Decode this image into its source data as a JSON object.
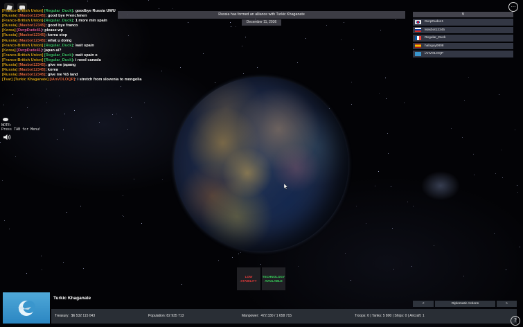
{
  "chat": [
    {
      "tag": "[Franco-British Union]",
      "name": "[Regular_Duck]",
      "name_color": "green",
      "message": "goodbye Russia UWU"
    },
    {
      "tag": "[Russia]",
      "name": "[Masbot12345]",
      "name_color": "orange",
      "message": "good bye Frenchmen"
    },
    {
      "tag": "[Franco-British Union]",
      "name": "[Regular_Duck]",
      "name_color": "green",
      "message": "1 more min spain"
    },
    {
      "tag": "[Russia]",
      "name": "[Masbot12345]",
      "name_color": "orange",
      "message": "good bye franco"
    },
    {
      "tag": "[Korea]",
      "name": "[DerpDude41]",
      "name_color": "pink",
      "message": "please wp"
    },
    {
      "tag": "[Russia]",
      "name": "[Masbot12345]",
      "name_color": "orange",
      "message": "korea stop"
    },
    {
      "tag": "[Russia]",
      "name": "[Masbot12345]",
      "name_color": "orange",
      "message": "what u doing"
    },
    {
      "tag": "[Franco-British Union]",
      "name": "[Regular_Duck]",
      "name_color": "green",
      "message": "wait spain"
    },
    {
      "tag": "[Korea]",
      "name": "[DerpDude41]",
      "name_color": "pink",
      "message": "japan ai?"
    },
    {
      "tag": "[Franco-British Union]",
      "name": "[Regular_Duck]",
      "name_color": "green",
      "message": "wait spain o"
    },
    {
      "tag": "[Franco-British Union]",
      "name": "[Regular_Duck]",
      "name_color": "green",
      "message": "i need canada"
    },
    {
      "tag": "[Russia]",
      "name": "[Masbot12345]",
      "name_color": "orange",
      "message": "give me japang"
    },
    {
      "tag": "[Russia]",
      "name": "[Masbot12345]",
      "name_color": "orange",
      "message": "korea"
    },
    {
      "tag": "[Russia]",
      "name": "[Masbot12345]",
      "name_color": "orange",
      "message": "give me %5 land"
    },
    {
      "tag": "[Tsar] [Turkic Khaganate]",
      "name": "[iAnVOLOQP]",
      "name_color": "orange",
      "message": "i stretch from slovenia to mongolia"
    }
  ],
  "announcement": "Russia has formed an alliance with Turkic Khaganate",
  "date": "December 11, 2036",
  "player_list": {
    "header": "V",
    "players": [
      {
        "name": "DerpDude41",
        "flag": "korea"
      },
      {
        "name": "Masbot12345",
        "flag": "russia"
      },
      {
        "name": "Regular_Duck",
        "flag": "franco-british"
      },
      {
        "name": "haloguy0808",
        "flag": "spain"
      },
      {
        "name": "iAnVOLOQP",
        "flag": "turkic"
      }
    ]
  },
  "note": {
    "line1": "NOTE:",
    "line2": "Press TAB for Menu!"
  },
  "badges": {
    "low_stability": "LOW STABILITY",
    "technology_available": "TECHNOLOGY AVAILABLE"
  },
  "country": {
    "name": "Turkic Khaganate",
    "treasury_label": "Treasury:",
    "treasury": "$6 532 115 043",
    "population_label": "Population:",
    "population": "82 935 713",
    "manpower_label": "Manpower:",
    "manpower": "472 330",
    "manpower_max": "1 658 715",
    "military": "Troops: 0  |  Tanks: 5 800  |  Ships: 0  |  Aircraft: 1"
  },
  "diplomacy": {
    "prev": "<",
    "label": "Diplomatic Actions",
    "next": ">"
  },
  "colors": {
    "low_stability": "#e33a3a",
    "technology_available": "#38d35a",
    "chat_tag": "#d4a017"
  }
}
